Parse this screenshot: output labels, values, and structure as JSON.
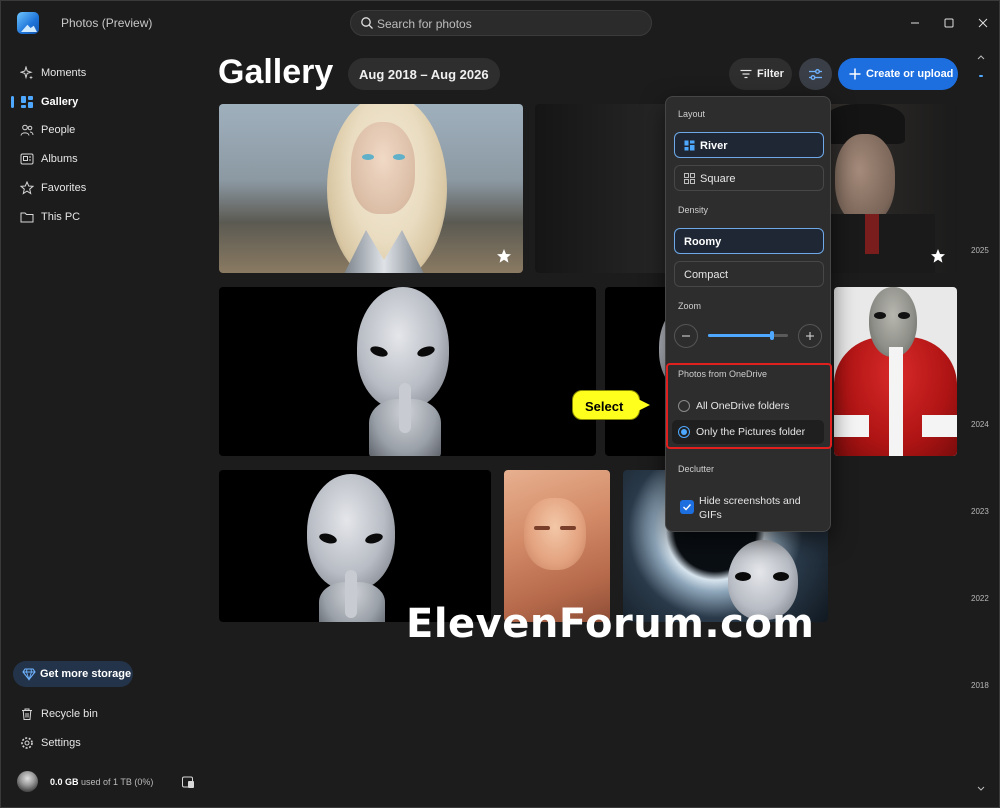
{
  "app": {
    "title": "Photos (Preview)",
    "search_placeholder": "Search for photos"
  },
  "sidebar": {
    "items": [
      {
        "label": "Moments",
        "icon": "sparkle-icon"
      },
      {
        "label": "Gallery",
        "icon": "gallery-icon",
        "active": true
      },
      {
        "label": "People",
        "icon": "people-icon"
      },
      {
        "label": "Albums",
        "icon": "albums-icon"
      },
      {
        "label": "Favorites",
        "icon": "star-icon"
      },
      {
        "label": "This PC",
        "icon": "folder-icon"
      }
    ],
    "get_storage_label": "Get more storage",
    "bottom_items": [
      {
        "label": "Recycle bin",
        "icon": "trash-icon"
      },
      {
        "label": "Settings",
        "icon": "gear-icon"
      }
    ],
    "storage_used": "0.0 GB",
    "storage_rest": "used of 1 TB (0%)"
  },
  "header": {
    "title": "Gallery",
    "date_range": "Aug 2018 – Aug 2026",
    "filter_label": "Filter",
    "create_label": "Create or upload"
  },
  "timeline": {
    "years": [
      "2025",
      "2024",
      "2023",
      "2022",
      "2018"
    ]
  },
  "flyout": {
    "layout_label": "Layout",
    "layout_options": [
      {
        "label": "River",
        "selected": true
      },
      {
        "label": "Square",
        "selected": false
      }
    ],
    "density_label": "Density",
    "density_options": [
      {
        "label": "Roomy",
        "selected": true
      },
      {
        "label": "Compact",
        "selected": false
      }
    ],
    "zoom_label": "Zoom",
    "zoom_level": 0.8,
    "onedrive_label": "Photos from OneDrive",
    "onedrive_options": [
      {
        "label": "All OneDrive folders",
        "selected": false
      },
      {
        "label": "Only the Pictures folder",
        "selected": true
      }
    ],
    "declutter_label": "Declutter",
    "declutter_checkbox": "Hide screenshots and GIFs",
    "declutter_checked": true
  },
  "callout": {
    "text": "Select"
  },
  "watermark": "ElevenForum.com",
  "colors": {
    "accent": "#1d6fe0",
    "highlight": "#e01f1f",
    "callout": "#ffff1e"
  }
}
